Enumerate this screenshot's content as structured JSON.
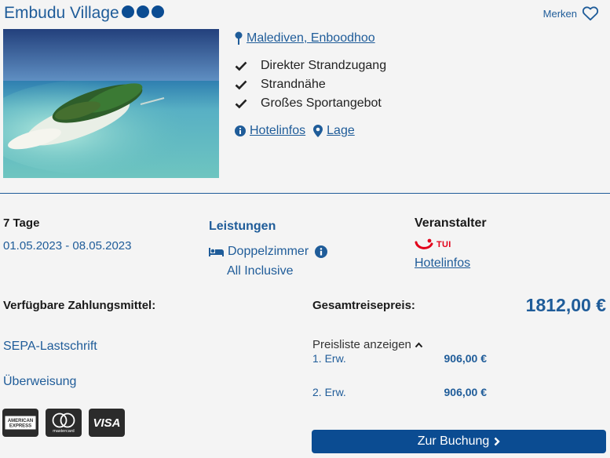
{
  "hotel": {
    "name": "Embudu Village",
    "rating": 3,
    "rating_color": "#0b4c92",
    "location": "Malediven, Enboodhoo",
    "features": [
      "Direkter Strandzugang",
      "Strandnähe",
      "Großes Sportangebot"
    ],
    "hotelinfos_link": "Hotelinfos",
    "lage_link": "Lage"
  },
  "header": {
    "merken_label": "Merken"
  },
  "trip": {
    "duration": "7 Tage",
    "dates": "01.05.2023 - 08.05.2023"
  },
  "services": {
    "title": "Leistungen",
    "room": "Doppelzimmer",
    "board": "All Inclusive"
  },
  "operator": {
    "title": "Veranstalter",
    "logo_text": "TUI",
    "link": "Hotelinfos"
  },
  "payment": {
    "title": "Verfügbare Zahlungsmittel:",
    "methods": [
      "SEPA-Lastschrift",
      "Überweisung"
    ],
    "cards": [
      "AMERICAN EXPRESS",
      "mastercard",
      "VISA"
    ]
  },
  "price": {
    "total_label": "Gesamtreisepreis:",
    "total": "1812,00 €",
    "toggle_label": "Preisliste anzeigen",
    "rows": [
      {
        "label": "1. Erw.",
        "amount": "906,00 €"
      },
      {
        "label": "2. Erw.",
        "amount": "906,00 €"
      }
    ]
  },
  "cta": {
    "label": "Zur Buchung"
  },
  "colors": {
    "brand_blue": "#1f5c99",
    "button_blue": "#0b4c92",
    "tui_red": "#e2001a",
    "panel_bg": "#f4f4f4"
  }
}
